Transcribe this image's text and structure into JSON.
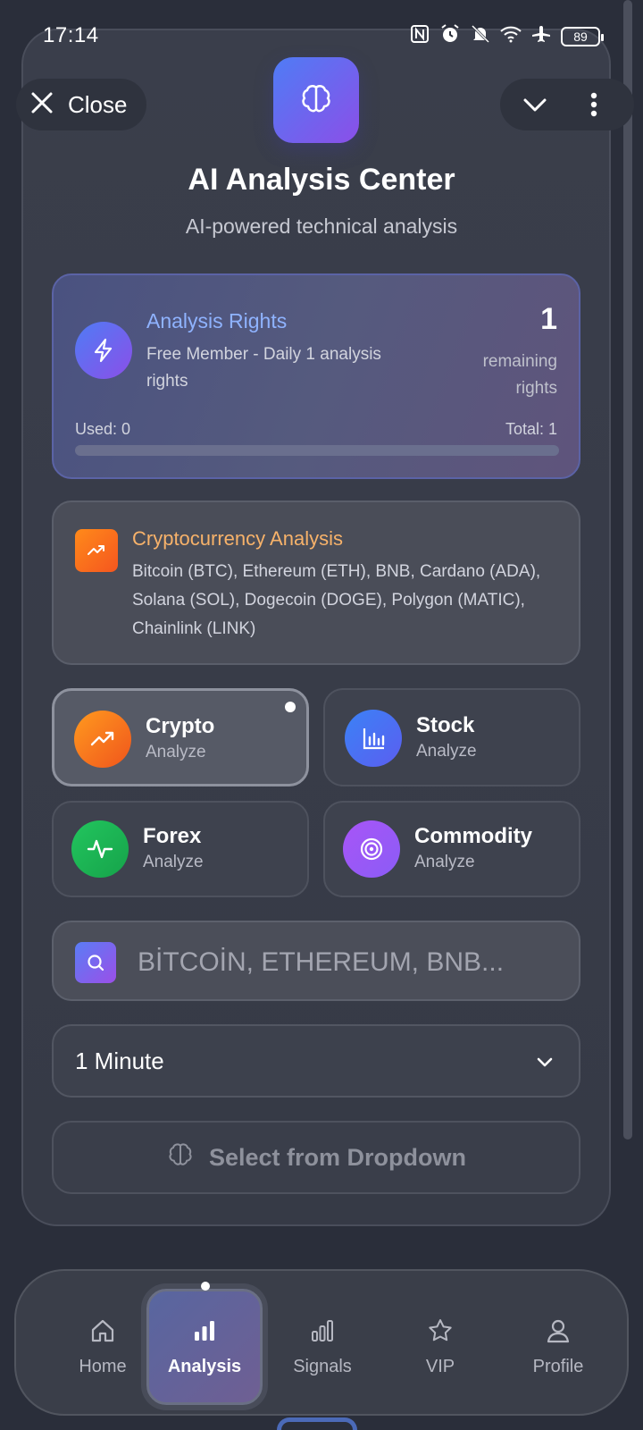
{
  "status_bar": {
    "time": "17:14",
    "battery": "89",
    "icons": [
      "nfc-icon",
      "alarm-icon",
      "mute-icon",
      "wifi-icon",
      "airplane-icon"
    ]
  },
  "header": {
    "close_label": "Close",
    "title": "AI Analysis Center",
    "subtitle": "AI-powered technical analysis"
  },
  "rights": {
    "title": "Analysis Rights",
    "description": "Free Member - Daily 1 analysis rights",
    "count": "1",
    "remaining_label": "remaining rights",
    "used_label": "Used: 0",
    "total_label": "Total: 1",
    "used_fraction": 0
  },
  "crypto_info": {
    "title": "Cryptocurrency Analysis",
    "description": "Bitcoin (BTC), Ethereum (ETH), BNB, Cardano (ADA), Solana (SOL), Dogecoin (DOGE), Polygon (MATIC), Chainlink (LINK)"
  },
  "categories": [
    {
      "name": "Crypto",
      "sub": "Analyze",
      "selected": true,
      "color": "#f97316"
    },
    {
      "name": "Stock",
      "sub": "Analyze",
      "selected": false,
      "color": "#4f6ef7"
    },
    {
      "name": "Forex",
      "sub": "Analyze",
      "selected": false,
      "color": "#22c55e"
    },
    {
      "name": "Commodity",
      "sub": "Analyze",
      "selected": false,
      "color": "#9d5cf0"
    }
  ],
  "search": {
    "placeholder": "BİTCOİN, ETHEREUM, BNB...",
    "value": ""
  },
  "timeframe": {
    "selected": "1 Minute"
  },
  "analyze_button": {
    "label": "Select from Dropdown"
  },
  "nav": {
    "items": [
      {
        "label": "Home",
        "icon": "home-icon",
        "active": false
      },
      {
        "label": "Analysis",
        "icon": "bar-chart-icon",
        "active": true
      },
      {
        "label": "Signals",
        "icon": "signals-icon",
        "active": false
      },
      {
        "label": "VIP",
        "icon": "star-icon",
        "active": false
      },
      {
        "label": "Profile",
        "icon": "profile-icon",
        "active": false
      }
    ]
  },
  "colors": {
    "accent_blue": "#8fb3ff",
    "accent_orange": "#f7b26a",
    "background": "#2a2e3a"
  }
}
